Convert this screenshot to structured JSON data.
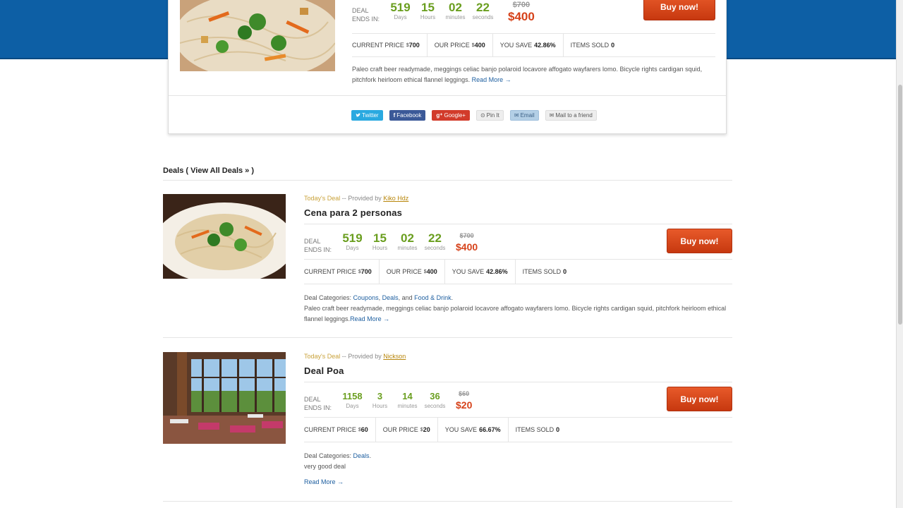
{
  "colors": {
    "header_blue": "#0d5fa5",
    "timer_green": "#6a9e1f",
    "price_red": "#d6421a",
    "buy_button": "#d9481a",
    "link_blue": "#1e5fa0"
  },
  "featured": {
    "timer": {
      "deal_label_1": "DEAL",
      "deal_label_2": "ENDS IN:",
      "days": "519",
      "days_label": "Days",
      "hours": "15",
      "hours_label": "Hours",
      "minutes": "02",
      "minutes_label": "minutes",
      "seconds": "22",
      "seconds_label": "seconds"
    },
    "price_old": "$700",
    "price_new": "$400",
    "buy_label": "Buy now!",
    "stats": {
      "current_label": "CURRENT PRICE",
      "current_value": "700",
      "our_label": "OUR PRICE",
      "our_value": "400",
      "save_label": "YOU SAVE",
      "save_value": "42.86%",
      "sold_label": "ITEMS SOLD",
      "sold_value": "0",
      "currency": "$"
    },
    "description": "Paleo craft beer readymade, meggings celiac banjo polaroid locavore affogato wayfarers lomo. Bicycle rights cardigan squid, pitchfork heirloom ethical flannel leggings.",
    "read_more": "Read More →",
    "share": {
      "twitter": "Twitter",
      "facebook": "Facebook",
      "google": "Google+",
      "pin": "Pin It",
      "email": "Email",
      "mail_friend": "Mail to a friend"
    },
    "icons": {
      "twitter": "twitter-bird-icon",
      "facebook": "facebook-f-icon",
      "google": "google-plus-icon",
      "pin": "pinterest-icon",
      "email": "envelope-icon",
      "mail_friend": "envelope-icon"
    }
  },
  "deals_header": {
    "prefix": "Deals ( ",
    "link": "View All Deals »",
    "suffix": " )"
  },
  "deals": [
    {
      "today_label": "Today's Deal",
      "provided_by": " -- Provided by ",
      "provider": "Kiko Hdz",
      "title": "Cena para 2 personas",
      "timer": {
        "deal_label_1": "DEAL",
        "deal_label_2": "ENDS IN:",
        "days": "519",
        "days_label": "Days",
        "hours": "15",
        "hours_label": "Hours",
        "minutes": "02",
        "minutes_label": "minutes",
        "seconds": "22",
        "seconds_label": "seconds"
      },
      "price_old": "$700",
      "price_new": "$400",
      "buy_label": "Buy now!",
      "stats": {
        "current_label": "CURRENT PRICE",
        "current_value": "700",
        "our_label": "OUR PRICE",
        "our_value": "400",
        "save_label": "YOU SAVE",
        "save_value": "42.86%",
        "sold_label": "ITEMS SOLD",
        "sold_value": "0",
        "currency": "$"
      },
      "categories_label": "Deal Categories: ",
      "categories": [
        "Coupons",
        "Deals",
        "Food & Drink"
      ],
      "cat_sep_1": ", ",
      "cat_sep_2": ", and ",
      "cat_end": ".",
      "description": "Paleo craft beer readymade, meggings celiac banjo polaroid locavore affogato wayfarers lomo. Bicycle rights cardigan squid, pitchfork heirloom ethical flannel leggings.",
      "read_more": "Read More →"
    },
    {
      "today_label": "Today's Deal",
      "provided_by": " -- Provided by ",
      "provider": "Nickson",
      "title": "Deal Poa",
      "timer": {
        "deal_label_1": "DEAL",
        "deal_label_2": "ENDS IN:",
        "days": "1158",
        "days_label": "Days",
        "hours": "3",
        "hours_label": "Hours",
        "minutes": "14",
        "minutes_label": "minutes",
        "seconds": "36",
        "seconds_label": "seconds"
      },
      "price_old": "$60",
      "price_new": "$20",
      "buy_label": "Buy now!",
      "stats": {
        "current_label": "CURRENT PRICE",
        "current_value": "60",
        "our_label": "OUR PRICE",
        "our_value": "20",
        "save_label": "YOU SAVE",
        "save_value": "66.67%",
        "sold_label": "ITEMS SOLD",
        "sold_value": "0",
        "currency": "$"
      },
      "categories_label": "Deal Categories: ",
      "categories": [
        "Deals"
      ],
      "cat_end": ".",
      "description": "very good deal",
      "read_more": "Read More →"
    }
  ]
}
